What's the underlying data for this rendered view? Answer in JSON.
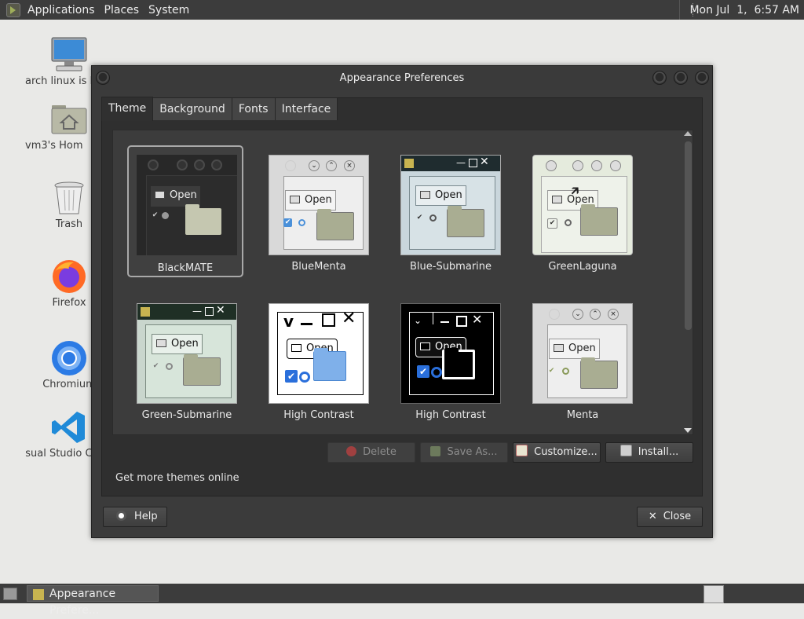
{
  "top_panel": {
    "menus": [
      "Applications",
      "Places",
      "System"
    ],
    "clock": "Mon Jul  1,  6:57 AM"
  },
  "desktop": {
    "icons": [
      {
        "label": "arch linux is b",
        "icon": "computer-icon"
      },
      {
        "label": "vm3's Hom",
        "icon": "home-folder-icon"
      },
      {
        "label": "Trash",
        "icon": "trash-icon"
      },
      {
        "label": "Firefox",
        "icon": "firefox-icon"
      },
      {
        "label": "Chromium",
        "icon": "chromium-icon"
      },
      {
        "label": "Visual Studio Co",
        "icon": "vscode-icon"
      }
    ]
  },
  "window": {
    "title": "Appearance Preferences",
    "tabs": [
      "Theme",
      "Background",
      "Fonts",
      "Interface"
    ],
    "active_tab": "Theme",
    "themes": [
      {
        "name": "BlackMATE",
        "selected": true
      },
      {
        "name": "BlueMenta",
        "selected": false
      },
      {
        "name": "Blue-Submarine",
        "selected": false
      },
      {
        "name": "GreenLaguna",
        "selected": false
      },
      {
        "name": "Green-Submarine",
        "selected": false
      },
      {
        "name": "High Contrast",
        "selected": false
      },
      {
        "name": "High Contrast",
        "selected": false
      },
      {
        "name": "Menta",
        "selected": false
      }
    ],
    "thumb_open_label": "Open",
    "buttons": {
      "delete": "Delete",
      "save_as": "Save As...",
      "customize": "Customize...",
      "install": "Install..."
    },
    "more_themes": "Get more themes online",
    "help": "Help",
    "close": "Close"
  },
  "bottom_panel": {
    "task_label": "Appearance Prefere..."
  },
  "colors": {
    "panel": "#3c3c3c",
    "window_bg": "#3b3b3b",
    "desktop_bg": "#e9e9e7",
    "selection_border": "#a9a9a9"
  }
}
